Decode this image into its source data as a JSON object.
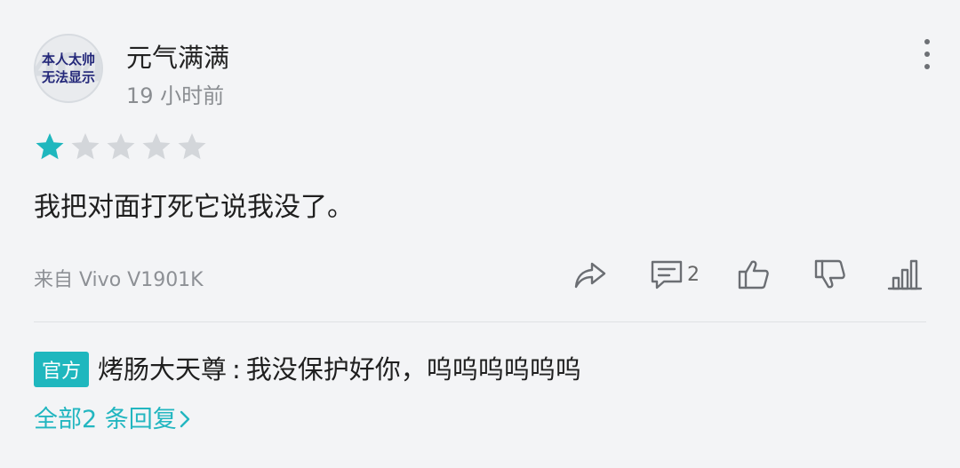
{
  "user": {
    "name": "元气满满",
    "time": "19 小时前",
    "avatar_lines": [
      "本人太帅",
      "无法显示"
    ]
  },
  "rating": {
    "value": 1,
    "max": 5,
    "filled_color": "#1fb7be",
    "empty_color": "#d3d6da"
  },
  "review": {
    "text": "我把对面打死它说我没了。"
  },
  "footer": {
    "source": "来自 Vivo V1901K",
    "comment_count": "2"
  },
  "icons": [
    "more-vertical-icon",
    "share-icon",
    "comment-icon",
    "thumbs-up-icon",
    "thumbs-down-icon",
    "stats-icon"
  ],
  "official_reply": {
    "badge": "官方",
    "author": "烤肠大天尊",
    "separator": ":",
    "text": "我没保护好你，呜呜呜呜呜呜"
  },
  "all_replies": {
    "label": "全部2 条回复"
  },
  "colors": {
    "accent": "#1fb7be",
    "text": "#1f1f1f",
    "muted": "#8d9095",
    "background": "#f3f4f6"
  }
}
